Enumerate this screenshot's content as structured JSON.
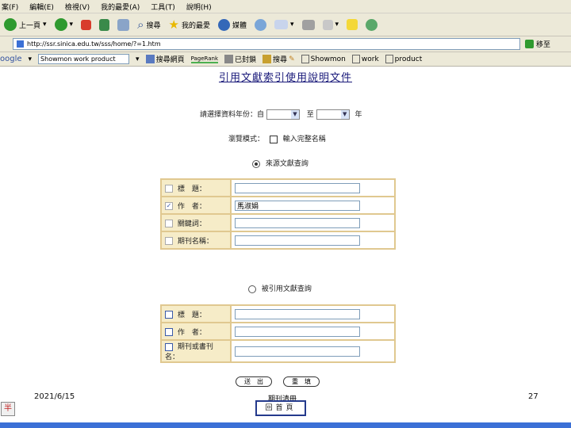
{
  "menu": [
    "案(F)",
    "編輯(E)",
    "檢視(V)",
    "我的最愛(A)",
    "工具(T)",
    "說明(H)"
  ],
  "toolbar": {
    "back": "上一頁",
    "search": "搜尋",
    "favorites": "我的最愛",
    "media": "媒體"
  },
  "address": {
    "url": "http://ssr.sinica.edu.tw/sss/home/?=1.htm",
    "go": "移至"
  },
  "google_bar": {
    "logo": "oogle",
    "query": "Showmon work product",
    "search_web": "搜尋網頁",
    "pagerank": "PageRank",
    "blocked": "已封鎖",
    "highlight": "搜尋",
    "term1": "Showmon",
    "term2": "work",
    "term3": "product"
  },
  "page": {
    "title": "引用文獻索引使用說明文件",
    "year_label": "請選擇資料年份：自",
    "year_to": "至",
    "year_suffix": "年",
    "browse_label": "瀏覽模式：",
    "browse_option": "輸入完整名稱",
    "section1_label": "來源文獻查詢",
    "section1_rows": [
      {
        "label": "標　題：",
        "value": "",
        "checked": false
      },
      {
        "label": "作　者：",
        "value": "馬淑娟",
        "checked": true
      },
      {
        "label": "關鍵詞：",
        "value": "",
        "checked": false
      },
      {
        "label": "期刊名稱：",
        "value": "",
        "checked": false
      }
    ],
    "section2_label": "被引用文獻查詢",
    "section2_rows": [
      {
        "label": "標　題：",
        "value": ""
      },
      {
        "label": "作　者：",
        "value": ""
      },
      {
        "label": "期刊或書刊名：",
        "value": ""
      }
    ],
    "submit": "送　出",
    "reset": "重　填",
    "journal_list": "期刊清冊",
    "home": "回首頁"
  },
  "footer": {
    "date": "2021/6/15",
    "page_number": "27"
  },
  "colors": {
    "chrome": "#ece9d8",
    "table_bg": "#f6ecc8",
    "table_border": "#e0c890",
    "title": "#1a1a7a",
    "nav_border": "#243a8c"
  }
}
